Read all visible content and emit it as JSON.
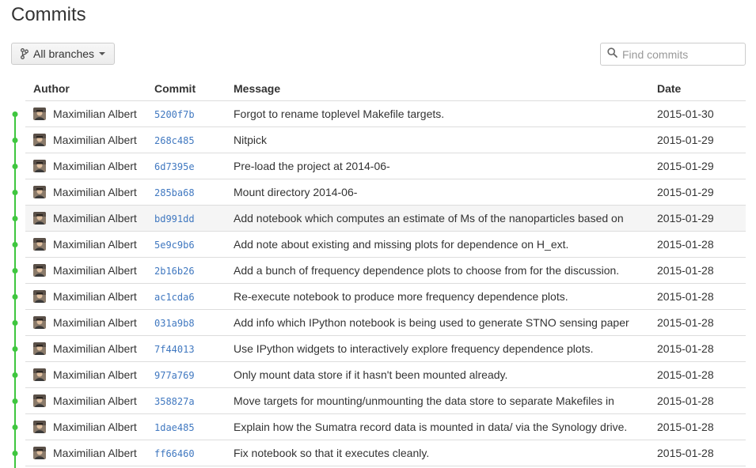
{
  "page": {
    "title": "Commits"
  },
  "toolbar": {
    "branch_label": "All branches",
    "search_placeholder": "Find commits"
  },
  "table": {
    "headers": {
      "author": "Author",
      "commit": "Commit",
      "message": "Message",
      "date": "Date"
    },
    "rows": [
      {
        "author": "Maximilian Albert",
        "sha": "5200f7b",
        "message": "Forgot to rename toplevel Makefile targets.",
        "date": "2015-01-30"
      },
      {
        "author": "Maximilian Albert",
        "sha": "268c485",
        "message": "Nitpick",
        "date": "2015-01-29"
      },
      {
        "author": "Maximilian Albert",
        "sha": "6d7395e",
        "message": "Pre-load the project at 2014-06-",
        "date": "2015-01-29"
      },
      {
        "author": "Maximilian Albert",
        "sha": "285ba68",
        "message": "Mount directory 2014-06-",
        "date": "2015-01-29"
      },
      {
        "author": "Maximilian Albert",
        "sha": "bd991dd",
        "message": "Add notebook which computes an estimate of Ms of the nanoparticles based on",
        "date": "2015-01-29"
      },
      {
        "author": "Maximilian Albert",
        "sha": "5e9c9b6",
        "message": "Add note about existing and missing plots for dependence on H_ext.",
        "date": "2015-01-28"
      },
      {
        "author": "Maximilian Albert",
        "sha": "2b16b26",
        "message": "Add a bunch of frequency dependence plots to choose from for the discussion.",
        "date": "2015-01-28"
      },
      {
        "author": "Maximilian Albert",
        "sha": "ac1cda6",
        "message": "Re-execute notebook to produce more frequency dependence plots.",
        "date": "2015-01-28"
      },
      {
        "author": "Maximilian Albert",
        "sha": "031a9b8",
        "message": "Add info which IPython notebook is being used to generate STNO sensing paper",
        "date": "2015-01-28"
      },
      {
        "author": "Maximilian Albert",
        "sha": "7f44013",
        "message": "Use IPython widgets to interactively explore frequency dependence plots.",
        "date": "2015-01-28"
      },
      {
        "author": "Maximilian Albert",
        "sha": "977a769",
        "message": "Only mount data store if it hasn't been mounted already.",
        "date": "2015-01-28"
      },
      {
        "author": "Maximilian Albert",
        "sha": "358827a",
        "message": "Move targets for mounting/unmounting the data store to separate Makefiles in",
        "date": "2015-01-28"
      },
      {
        "author": "Maximilian Albert",
        "sha": "1dae485",
        "message": "Explain how the Sumatra record data is mounted in data/ via the Synology drive.",
        "date": "2015-01-28"
      },
      {
        "author": "Maximilian Albert",
        "sha": "ff66460",
        "message": "Fix notebook so that it executes cleanly.",
        "date": "2015-01-28"
      }
    ]
  },
  "colors": {
    "graph_line": "#3fc63f",
    "sha_link": "#4078c0",
    "hover_row": "#f5f5f5"
  },
  "icons": {
    "branch": "git-branch-icon",
    "search": "search-icon",
    "avatar": "user-avatar"
  }
}
